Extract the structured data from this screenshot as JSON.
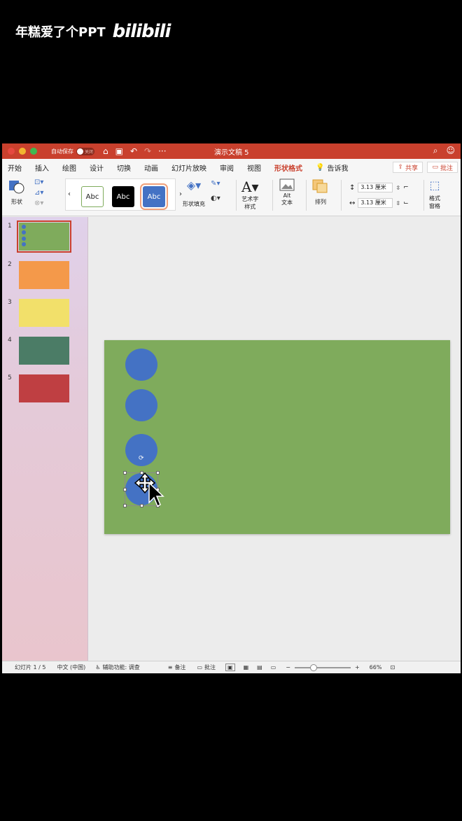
{
  "watermark": {
    "text": "年糕爱了个PPT",
    "logo": "bilibili"
  },
  "titlebar": {
    "autosave_label": "自动保存",
    "autosave_state": "关闭",
    "doc_title": "演示文稿 5",
    "colors": {
      "bar": "#c9402d",
      "close": "#e5483f",
      "min": "#f2b530",
      "max": "#3fb950"
    }
  },
  "tabs": [
    {
      "label": "开始"
    },
    {
      "label": "插入"
    },
    {
      "label": "绘图"
    },
    {
      "label": "设计"
    },
    {
      "label": "切换"
    },
    {
      "label": "动画"
    },
    {
      "label": "幻灯片放映"
    },
    {
      "label": "审阅"
    },
    {
      "label": "视图"
    },
    {
      "label": "形状格式",
      "active": true
    }
  ],
  "tell_me": "告诉我",
  "share": "共享",
  "comment": "批注",
  "ribbon": {
    "shape_label": "形状",
    "styles": [
      {
        "text": "Abc",
        "style": "outline"
      },
      {
        "text": "Abc",
        "style": "black"
      },
      {
        "text": "Abc",
        "style": "blue",
        "selected": true
      }
    ],
    "shape_fill": "形状填充",
    "wordart_line1": "艺术字",
    "wordart_line2": "样式",
    "alt_line1": "Alt",
    "alt_line2": "文本",
    "arrange": "排列",
    "height": "3.13 厘米",
    "width": "3.13 厘米",
    "format_line1": "格式",
    "format_line2": "窗格"
  },
  "slides_panel": [
    {
      "num": "1",
      "color": "#7fab5c",
      "selected": true
    },
    {
      "num": "2",
      "color": "#f4994a"
    },
    {
      "num": "3",
      "color": "#f2e06a"
    },
    {
      "num": "4",
      "color": "#4b7c66"
    },
    {
      "num": "5",
      "color": "#bf3f42"
    }
  ],
  "slide": {
    "background": "#7fab5c",
    "circle_color": "#4472c4",
    "circle_count": 4
  },
  "status": {
    "slide_info": "幻灯片 1 / 5",
    "language": "中文 (中国)",
    "accessibility": "辅助功能: 调查",
    "notes": "备注",
    "comments": "批注",
    "zoom": "66%"
  }
}
